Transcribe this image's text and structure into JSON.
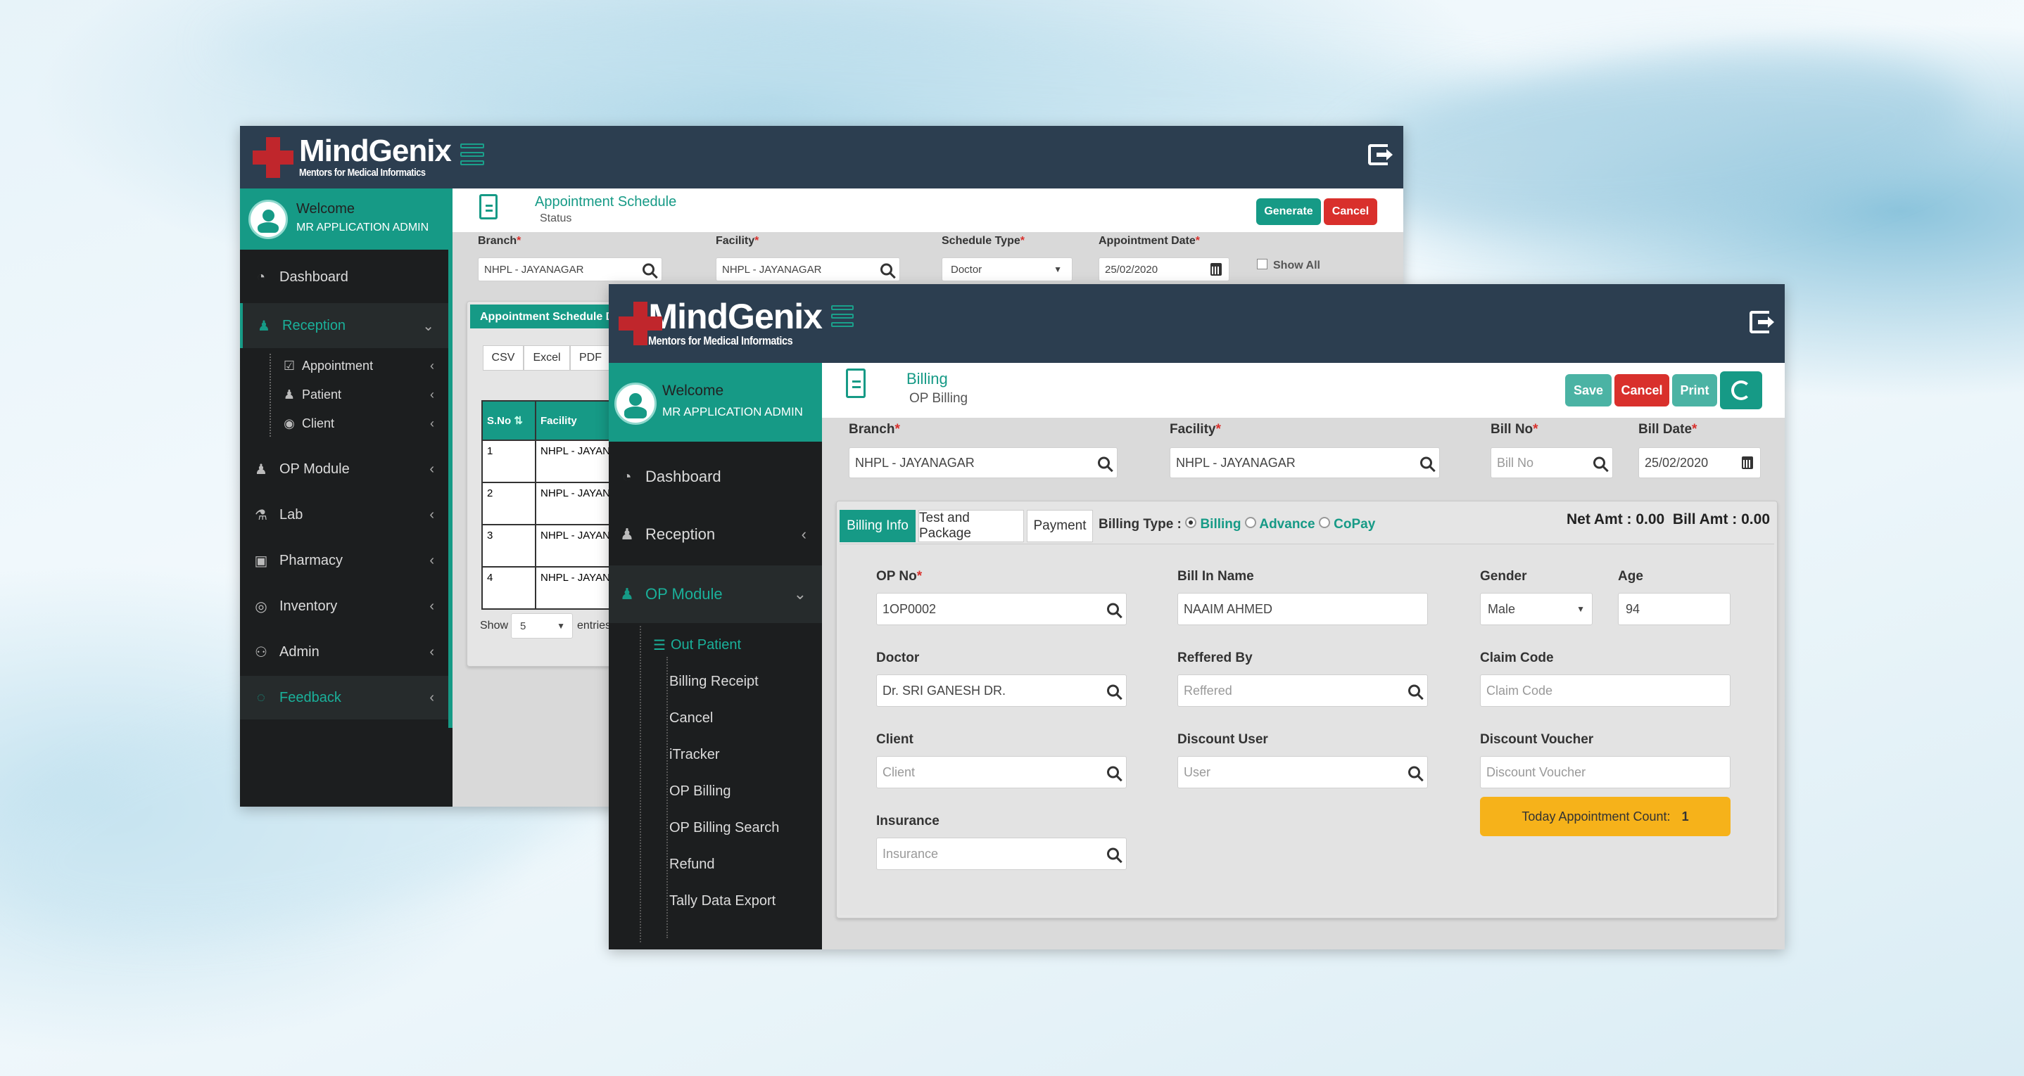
{
  "brand": {
    "name": "MindGenix",
    "tagline": "Mentors for Medical Informatics"
  },
  "user": {
    "welcome": "Welcome",
    "name": "MR APPLICATION ADMIN"
  },
  "back_window": {
    "page_title": "Appointment Schedule",
    "page_subtitle": "Status",
    "buttons": {
      "generate": "Generate",
      "cancel": "Cancel"
    },
    "filters": {
      "branch": {
        "label": "Branch",
        "value": "NHPL - JAYANAGAR"
      },
      "facility": {
        "label": "Facility",
        "value": "NHPL - JAYANAGAR"
      },
      "schedule_type": {
        "label": "Schedule Type",
        "value": "Doctor"
      },
      "appointment_date": {
        "label": "Appointment Date",
        "value": "25/02/2020"
      },
      "show_all": "Show All"
    },
    "panel_title": "Appointment Schedule De",
    "export_buttons": [
      "CSV",
      "Excel",
      "PDF"
    ],
    "table": {
      "headers": [
        "S.No",
        "Facility"
      ],
      "rows": [
        {
          "sno": "1",
          "facility": "NHPL - JAYANAGAR"
        },
        {
          "sno": "2",
          "facility": "NHPL - JAYANAGAR"
        },
        {
          "sno": "3",
          "facility": "NHPL - JAYANAGAR"
        },
        {
          "sno": "4",
          "facility": "NHPL - JAYANAGAR"
        }
      ]
    },
    "show_label": "Show",
    "show_value": "5",
    "entries_label": "entries",
    "sidebar": [
      {
        "label": "Dashboard",
        "icon": "dashboard-icon"
      },
      {
        "label": "Reception",
        "icon": "user-icon",
        "active": true
      },
      {
        "label": "Appointment",
        "icon": "check-square-icon",
        "sub": true
      },
      {
        "label": "Patient",
        "icon": "user-icon",
        "sub": true
      },
      {
        "label": "Client",
        "icon": "eye-icon",
        "sub": true
      },
      {
        "label": "OP Module",
        "icon": "user-icon"
      },
      {
        "label": "Lab",
        "icon": "flask-icon"
      },
      {
        "label": "Pharmacy",
        "icon": "medkit-icon"
      },
      {
        "label": "Inventory",
        "icon": "user-circle-icon"
      },
      {
        "label": "Admin",
        "icon": "users-icon"
      },
      {
        "label": "Feedback",
        "icon": "comment-icon",
        "active": true
      }
    ]
  },
  "front_window": {
    "page_title": "Billing",
    "page_subtitle": "OP Billing",
    "buttons": {
      "save": "Save",
      "cancel": "Cancel",
      "print": "Print"
    },
    "header_fields": {
      "branch": {
        "label": "Branch",
        "value": "NHPL - JAYANAGAR"
      },
      "facility": {
        "label": "Facility",
        "value": "NHPL - JAYANAGAR"
      },
      "bill_no": {
        "label": "Bill No",
        "placeholder": "Bill No"
      },
      "bill_date": {
        "label": "Bill Date",
        "value": "25/02/2020"
      }
    },
    "tabs": [
      "Billing Info",
      "Test and Package",
      "Payment"
    ],
    "billing_type": {
      "label": "Billing Type :",
      "options": [
        "Billing",
        "Advance",
        "CoPay"
      ],
      "selected": "Billing"
    },
    "amounts": {
      "net": "Net Amt : 0.00",
      "bill": "Bill Amt : 0.00"
    },
    "form": {
      "op_no": {
        "label": "OP No",
        "value": "1OP0002"
      },
      "bill_in_name": {
        "label": "Bill In Name",
        "value": "NAAIM AHMED"
      },
      "gender": {
        "label": "Gender",
        "value": "Male"
      },
      "age": {
        "label": "Age",
        "value": "94"
      },
      "doctor": {
        "label": "Doctor",
        "value": "Dr. SRI GANESH DR."
      },
      "reffered_by": {
        "label": "Reffered By",
        "placeholder": "Reffered"
      },
      "claim_code": {
        "label": "Claim Code",
        "placeholder": "Claim Code"
      },
      "client": {
        "label": "Client",
        "placeholder": "Client"
      },
      "discount_user": {
        "label": "Discount User",
        "placeholder": "User"
      },
      "discount_voucher": {
        "label": "Discount Voucher",
        "placeholder": "Discount Voucher"
      },
      "insurance": {
        "label": "Insurance",
        "placeholder": "Insurance"
      }
    },
    "appointment_count": {
      "label": "Today Appointment Count:",
      "value": "1"
    },
    "sidebar": [
      {
        "label": "Dashboard",
        "icon": "dashboard-icon"
      },
      {
        "label": "Reception",
        "icon": "user-icon"
      },
      {
        "label": "OP Module",
        "icon": "user-icon",
        "active": true
      },
      {
        "label": "Out Patient",
        "icon": "list-icon",
        "sub": true,
        "active": true
      },
      {
        "label": "Billing Receipt",
        "sub2": true
      },
      {
        "label": "Cancel",
        "sub2": true
      },
      {
        "label": "iTracker",
        "sub2": true
      },
      {
        "label": "OP Billing",
        "sub2": true
      },
      {
        "label": "OP Billing Search",
        "sub2": true
      },
      {
        "label": "Refund",
        "sub2": true
      },
      {
        "label": "Tally Data Export",
        "sub2": true
      }
    ]
  },
  "colors": {
    "teal": "#169a86",
    "dark": "#2c3e50",
    "sidebar": "#1c1e1f",
    "red": "#d9302c",
    "amber": "#f6b21a"
  }
}
